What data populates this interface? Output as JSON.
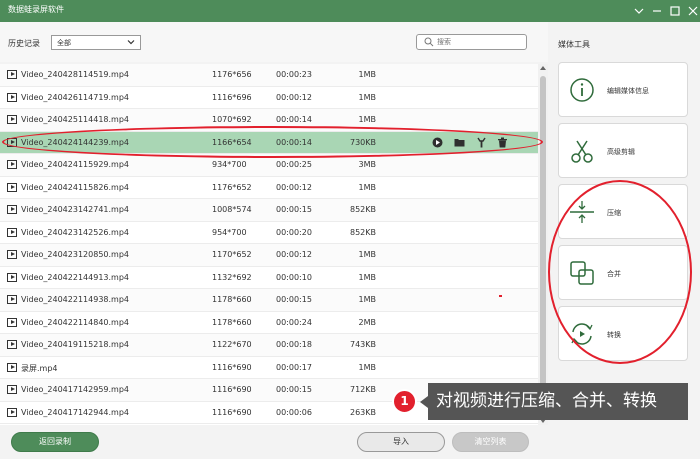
{
  "window": {
    "title": "数据蛙录屏软件",
    "controls": [
      "pin-icon",
      "minimize-icon",
      "maximize-icon",
      "close-icon"
    ]
  },
  "filter": {
    "label": "历史记录",
    "select_value": "全部",
    "search_placeholder": "搜索"
  },
  "files": [
    {
      "name": "Video_240428114519.mp4",
      "resolution": "1176*656",
      "duration": "00:00:23",
      "size": "1MB"
    },
    {
      "name": "Video_240426114719.mp4",
      "resolution": "1116*696",
      "duration": "00:00:12",
      "size": "1MB"
    },
    {
      "name": "Video_240425114418.mp4",
      "resolution": "1070*692",
      "duration": "00:00:14",
      "size": "1MB"
    },
    {
      "name": "Video_240424144239.mp4",
      "resolution": "1166*654",
      "duration": "00:00:14",
      "size": "730KB",
      "selected": true
    },
    {
      "name": "Video_240424115929.mp4",
      "resolution": "934*700",
      "duration": "00:00:25",
      "size": "3MB"
    },
    {
      "name": "Video_240424115826.mp4",
      "resolution": "1176*652",
      "duration": "00:00:12",
      "size": "1MB"
    },
    {
      "name": "Video_240423142741.mp4",
      "resolution": "1008*574",
      "duration": "00:00:15",
      "size": "852KB"
    },
    {
      "name": "Video_240423142526.mp4",
      "resolution": "954*700",
      "duration": "00:00:20",
      "size": "852KB"
    },
    {
      "name": "Video_240423120850.mp4",
      "resolution": "1170*652",
      "duration": "00:00:12",
      "size": "1MB"
    },
    {
      "name": "Video_240422144913.mp4",
      "resolution": "1132*692",
      "duration": "00:00:10",
      "size": "1MB"
    },
    {
      "name": "Video_240422114938.mp4",
      "resolution": "1178*660",
      "duration": "00:00:15",
      "size": "1MB"
    },
    {
      "name": "Video_240422114840.mp4",
      "resolution": "1178*660",
      "duration": "00:00:24",
      "size": "2MB"
    },
    {
      "name": "Video_240419115218.mp4",
      "resolution": "1122*670",
      "duration": "00:00:18",
      "size": "743KB"
    },
    {
      "name": "录屏.mp4",
      "resolution": "1116*690",
      "duration": "00:00:17",
      "size": "1MB"
    },
    {
      "name": "Video_240417142959.mp4",
      "resolution": "1116*690",
      "duration": "00:00:15",
      "size": "712KB"
    },
    {
      "name": "Video_240417142944.mp4",
      "resolution": "1116*690",
      "duration": "00:00:06",
      "size": "263KB"
    }
  ],
  "row_actions": [
    "play-icon",
    "folder-icon",
    "edit-tools-icon",
    "trash-icon"
  ],
  "tools": {
    "title": "媒体工具",
    "items": [
      {
        "label": "编辑媒体信息",
        "icon": "info-icon"
      },
      {
        "label": "高级剪辑",
        "icon": "scissors-icon"
      },
      {
        "label": "压缩",
        "icon": "compress-icon"
      },
      {
        "label": "合并",
        "icon": "merge-icon"
      },
      {
        "label": "转换",
        "icon": "convert-icon"
      }
    ]
  },
  "footer": {
    "back_label": "返回录制",
    "import_label": "导入",
    "clear_label": "清空列表"
  },
  "annotation": {
    "badge": "1",
    "text": "对视频进行压缩、合并、转换"
  },
  "colors": {
    "brand": "#4e8c5a",
    "selected_row": "#a9d6b4",
    "annotation": "#e2202d"
  }
}
